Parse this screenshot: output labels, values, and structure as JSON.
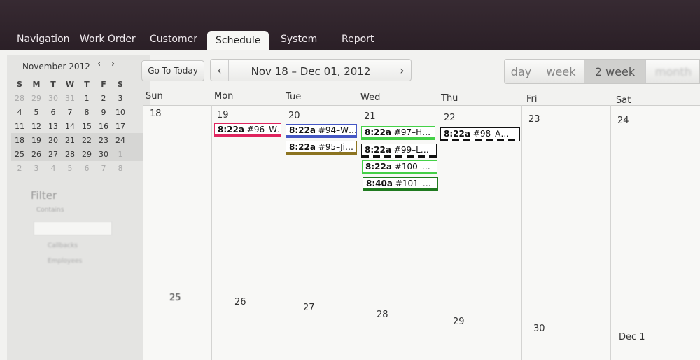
{
  "tabs": [
    {
      "label": "Navigation"
    },
    {
      "label": "Work Order"
    },
    {
      "label": "Customer"
    },
    {
      "label": "Schedule"
    },
    {
      "label": "System"
    },
    {
      "label": "Report"
    }
  ],
  "mini_calendar": {
    "month_label": "November 2012",
    "prev": "‹",
    "next": "›",
    "weekday_headers": [
      "S",
      "M",
      "T",
      "W",
      "T",
      "F",
      "S"
    ],
    "weeks": [
      [
        "28",
        "29",
        "30",
        "31",
        "1",
        "2",
        "3"
      ],
      [
        "4",
        "5",
        "6",
        "7",
        "8",
        "9",
        "10"
      ],
      [
        "11",
        "12",
        "13",
        "14",
        "15",
        "16",
        "17"
      ],
      [
        "18",
        "19",
        "20",
        "21",
        "22",
        "23",
        "24"
      ],
      [
        "25",
        "26",
        "27",
        "28",
        "29",
        "30",
        "1"
      ],
      [
        "2",
        "3",
        "4",
        "5",
        "6",
        "7",
        "8"
      ]
    ]
  },
  "filter": {
    "title": "Filter",
    "contains_label": "Contains",
    "options": [
      "Callbacks",
      "Employees"
    ]
  },
  "toolbar": {
    "today_label": "Go To Today",
    "range_label": "Nov 18 – Dec 01, 2012",
    "prev": "‹",
    "next": "›",
    "views": [
      {
        "label": "day"
      },
      {
        "label": "week"
      },
      {
        "label": "2 week",
        "active": true
      },
      {
        "label": "month"
      }
    ]
  },
  "weekday_names": [
    "Sun",
    "Mon",
    "Tue",
    "Wed",
    "Thu",
    "Fri",
    "Sat"
  ],
  "week1_days": [
    "18",
    "19",
    "20",
    "21",
    "22",
    "23",
    "24"
  ],
  "week2_days": [
    "25",
    "26",
    "27",
    "28",
    "29",
    "30",
    "Dec 1"
  ],
  "events": [
    {
      "time": "8:22a",
      "title": "#96–W…",
      "color": "#e0245e"
    },
    {
      "time": "8:22a",
      "title": "#94–W…",
      "color": "#4557c4"
    },
    {
      "time": "8:22a",
      "title": "#95–Ji…",
      "color": "#8c7420"
    },
    {
      "time": "8:22a",
      "title": "#97–H…",
      "color": "#44d147"
    },
    {
      "time": "8:22a",
      "title": "#99–L…",
      "color": "#111111"
    },
    {
      "time": "8:22a",
      "title": "#100–…",
      "color": "#44d147"
    },
    {
      "time": "8:40a",
      "title": "#101–…",
      "color": "#1f7a1f"
    },
    {
      "time": "8:22a",
      "title": "#98–A…",
      "color": "#111111"
    }
  ]
}
